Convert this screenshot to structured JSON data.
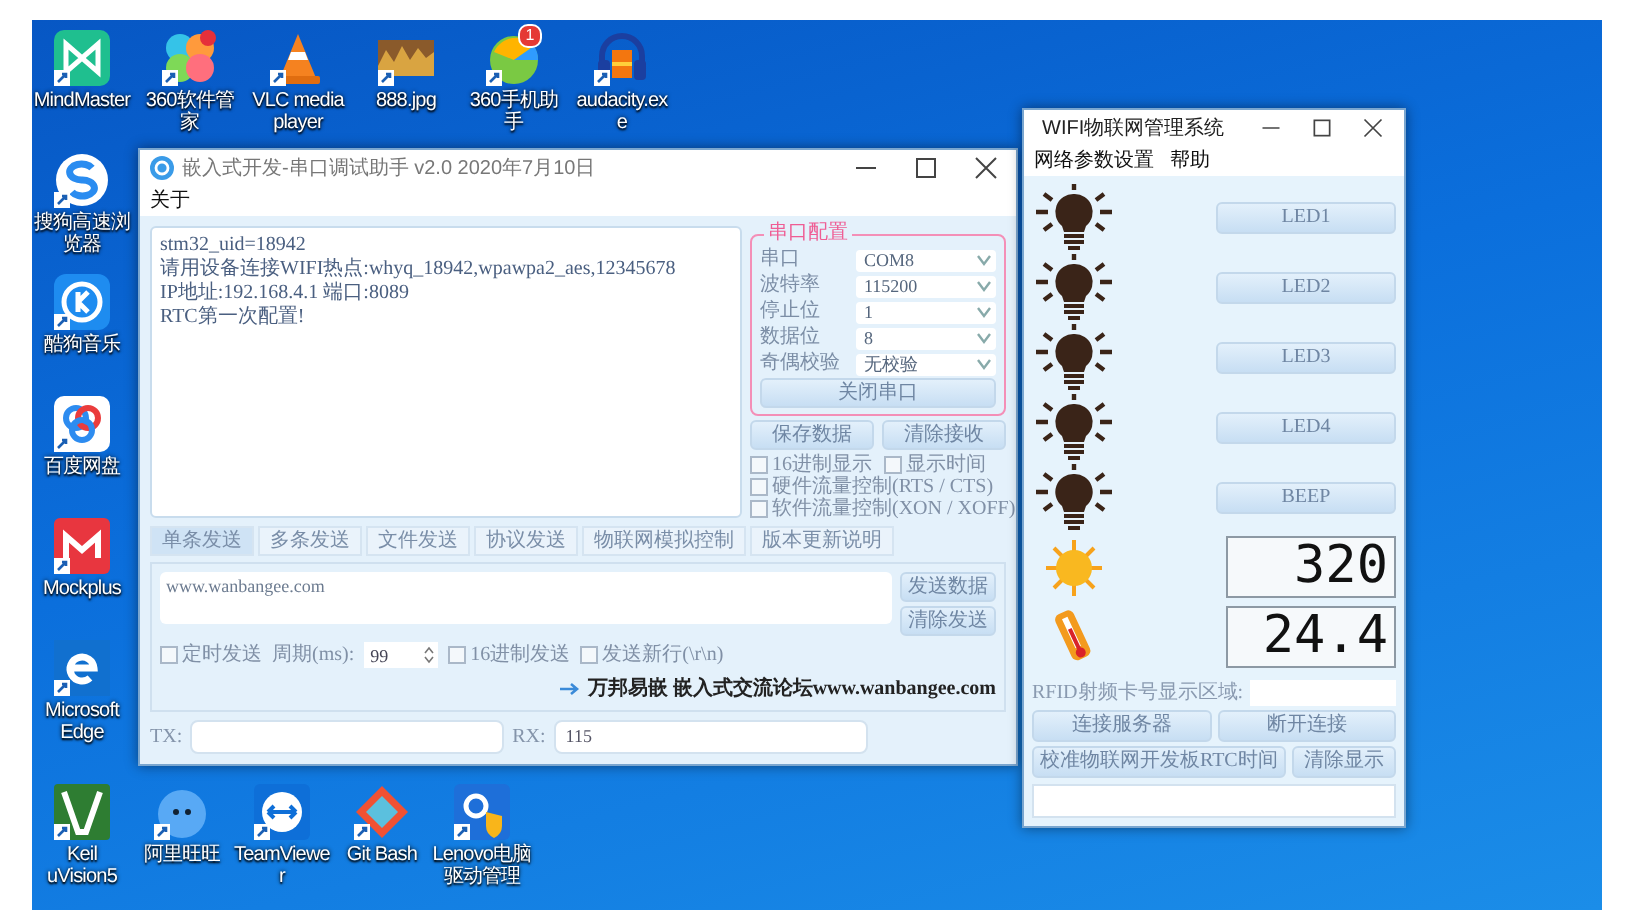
{
  "desktop_icons": {
    "top_row": [
      {
        "label": "MindMaster",
        "kind": "mindmaster"
      },
      {
        "label": "360软件管家",
        "kind": "petals"
      },
      {
        "label": "VLC media player",
        "kind": "cone"
      },
      {
        "label": "888.jpg",
        "kind": "image"
      },
      {
        "label": "360手机助手",
        "kind": "phone",
        "badge": "1"
      },
      {
        "label": "audacity.exe",
        "kind": "headphones"
      }
    ],
    "left_column": [
      {
        "label": "搜狗高速浏览器",
        "kind": "browser"
      },
      {
        "label": "酷狗音乐",
        "kind": "music"
      },
      {
        "label": "百度网盘",
        "kind": "cloud"
      },
      {
        "label": "Mockplus",
        "kind": "mockplus"
      },
      {
        "label": "Microsoft Edge",
        "kind": "edge"
      }
    ],
    "bottom_row": [
      {
        "label": "Keil uVision5",
        "kind": "keil"
      },
      {
        "label": "阿里旺旺",
        "kind": "chat"
      },
      {
        "label": "TeamViewer",
        "kind": "teamviewer"
      },
      {
        "label": "Git Bash",
        "kind": "git"
      },
      {
        "label": "Lenovo电脑驱动管理",
        "kind": "driver"
      }
    ]
  },
  "serial_window": {
    "title": "嵌入式开发-串口调试助手 v2.0 2020年7月10日",
    "menu": [
      "关于"
    ],
    "receive_lines": [
      "stm32_uid=18942",
      "请用设备连接WIFI热点:whyq_18942,wpawpa2_aes,12345678",
      "IP地址:192.168.4.1 端口:8089",
      "RTC第一次配置!"
    ],
    "config": {
      "title": "串口配置",
      "fields": [
        {
          "label": "串口",
          "value": "COM8"
        },
        {
          "label": "波特率",
          "value": "115200"
        },
        {
          "label": "停止位",
          "value": "1"
        },
        {
          "label": "数据位",
          "value": "8"
        },
        {
          "label": "奇偶校验",
          "value": "无校验"
        }
      ],
      "action": "关闭串口"
    },
    "receive_buttons": [
      "保存数据",
      "清除接收"
    ],
    "receive_options": [
      {
        "label": "16进制显示",
        "checked": false
      },
      {
        "label": "显示时间",
        "checked": false
      },
      {
        "label": "硬件流量控制(RTS / CTS)",
        "checked": false
      },
      {
        "label": "软件流量控制(XON / XOFF)",
        "checked": false
      }
    ],
    "tabs": [
      {
        "label": "单条发送",
        "selected": true
      },
      {
        "label": "多条发送",
        "selected": false
      },
      {
        "label": "文件发送",
        "selected": false
      },
      {
        "label": "协议发送",
        "selected": false
      },
      {
        "label": "物联网模拟控制",
        "selected": false
      },
      {
        "label": "版本更新说明",
        "selected": false
      }
    ],
    "send_text": "www.wanbangee.com",
    "send_buttons": [
      "发送数据",
      "清除发送"
    ],
    "timed_send": {
      "label": "定时发送",
      "checked": false
    },
    "period_label": "周期(ms):",
    "period_value": "99",
    "send_options": [
      {
        "label": "16进制发送",
        "checked": false
      },
      {
        "label": "发送新行(\\r\\n)",
        "checked": false
      }
    ],
    "forum_link": "万邦易嵌  嵌入式交流论坛www.wanbangee.com",
    "tx_label": "TX:",
    "rx_label": "RX:",
    "rx_value": "115"
  },
  "wifi_window": {
    "title": "WIFI物联网管理系统",
    "menu": [
      "网络参数设置",
      "帮助"
    ],
    "devices": [
      {
        "label": "LED1"
      },
      {
        "label": "LED2"
      },
      {
        "label": "LED3"
      },
      {
        "label": "LED4"
      },
      {
        "label": "BEEP"
      }
    ],
    "sensors": [
      {
        "kind": "light",
        "value": "320"
      },
      {
        "kind": "temperature",
        "value": "24.4"
      }
    ],
    "rfid_label": "RFID射频卡号显示区域:",
    "button_rows": [
      [
        "连接服务器",
        "断开连接"
      ],
      [
        "校准物联网开发板RTC时间",
        "清除显示"
      ]
    ]
  }
}
